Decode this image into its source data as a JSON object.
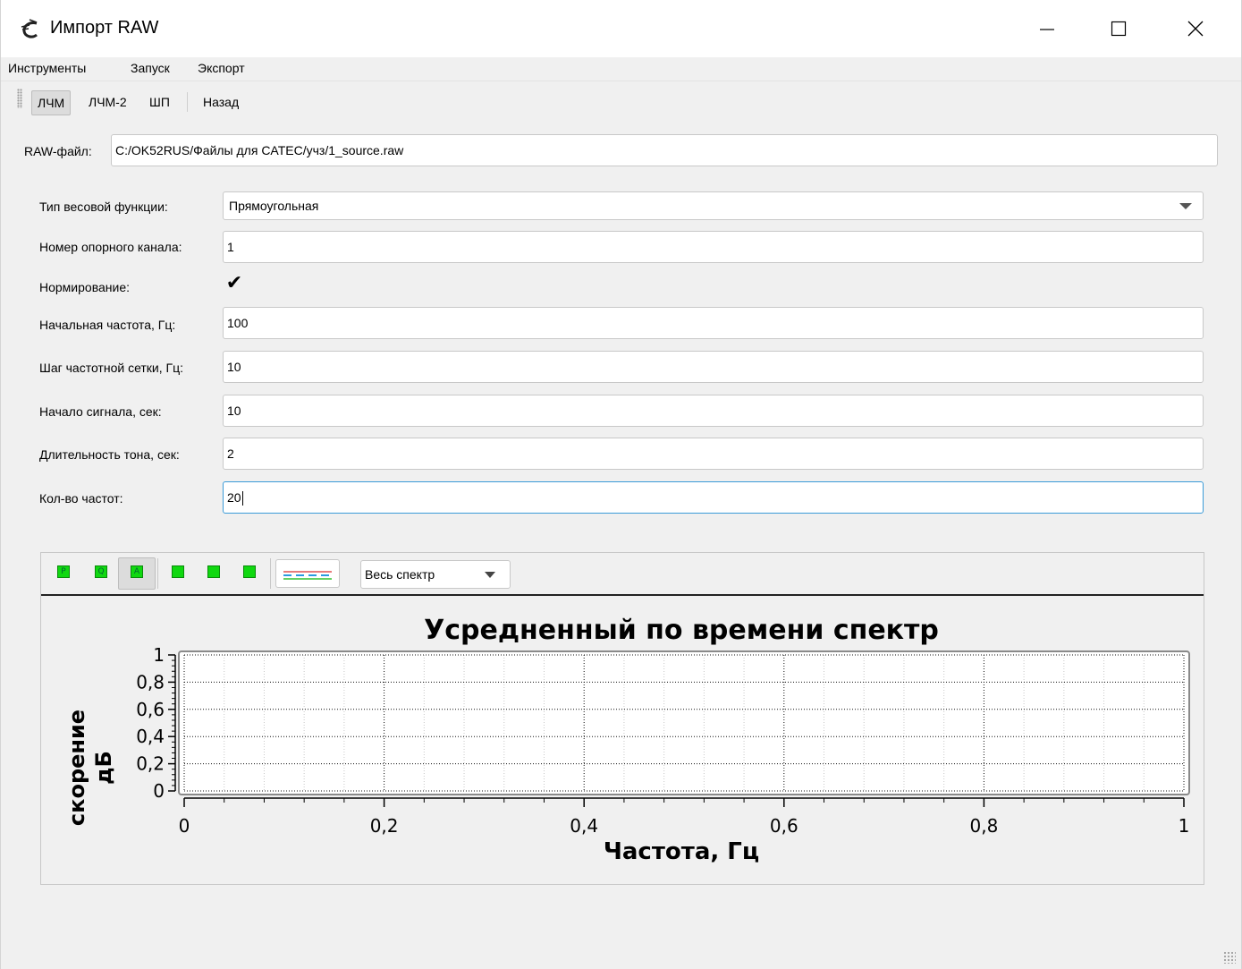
{
  "window": {
    "title": "Импорт RAW",
    "minimize_glyph": "—",
    "close_glyph": "✕"
  },
  "menu": {
    "items": [
      "Инструменты",
      "Запуск",
      "Экспорт"
    ]
  },
  "toolbar": {
    "buttons": [
      "ЛЧМ",
      "ЛЧМ-2",
      "ШП",
      "Назад"
    ],
    "active": "ЛЧМ"
  },
  "raw_file": {
    "label": "RAW-файл:",
    "value": "C:/OK52RUS/Файлы для CATEC/учз/1_source.raw"
  },
  "form": {
    "window_type": {
      "label": "Тип весовой функции:",
      "value": "Прямоугольная"
    },
    "ref_channel": {
      "label": "Номер опорного канала:",
      "value": "1"
    },
    "normalize": {
      "label": "Нормирование:",
      "checked": true,
      "glyph": "✔"
    },
    "start_freq": {
      "label": "Начальная частота, Гц:",
      "value": "100"
    },
    "freq_step": {
      "label": "Шаг частотной сетки, Гц:",
      "value": "10"
    },
    "signal_start": {
      "label": "Начало сигнала, сек:",
      "value": "10"
    },
    "tone_duration": {
      "label": "Длительность тона, сек:",
      "value": "2"
    },
    "freq_count": {
      "label": "Кол-во частот:",
      "value": "20"
    }
  },
  "chart_toolbar": {
    "icons": [
      "pan-icon",
      "zoom-icon",
      "autoscale-icon",
      "fit-icon",
      "horizontal-fit-icon",
      "vertical-fit-icon"
    ],
    "icon_letters": [
      "P",
      "Q",
      "A",
      "",
      "",
      ""
    ],
    "spectrum_select": "Весь спектр",
    "legend_colors": [
      "#e05050",
      "#2a9be0",
      "#30c030"
    ]
  },
  "chart_data": {
    "type": "line",
    "title": "Усредненный по времени спектр",
    "xlabel": "Частота, Гц",
    "ylabel_lines": [
      "скорение",
      "дБ"
    ],
    "x_ticks": [
      "0",
      "0,2",
      "0,4",
      "0,6",
      "0,8",
      "1"
    ],
    "y_ticks": [
      "0",
      "0,2",
      "0,4",
      "0,6",
      "0,8",
      "1"
    ],
    "xlim": [
      0,
      1
    ],
    "ylim": [
      0,
      1
    ],
    "grid": true,
    "series": []
  }
}
